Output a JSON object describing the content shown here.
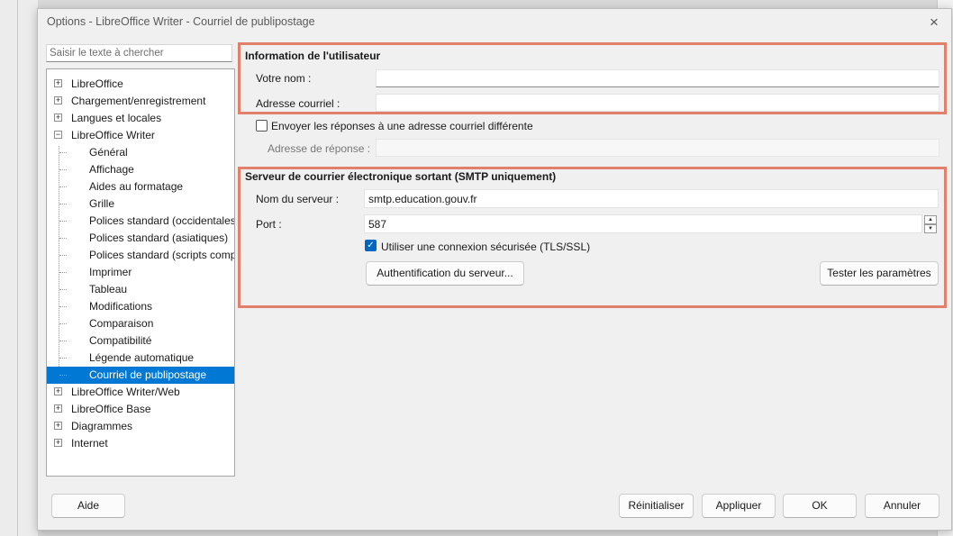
{
  "window": {
    "title": "Options - LibreOffice Writer - Courriel de publipostage",
    "close_icon": "×"
  },
  "search": {
    "placeholder": "Saisir le texte à chercher"
  },
  "tree": {
    "items": [
      {
        "label": "LibreOffice",
        "level": 0,
        "expander": "+"
      },
      {
        "label": "Chargement/enregistrement",
        "level": 0,
        "expander": "+"
      },
      {
        "label": "Langues et locales",
        "level": 0,
        "expander": "+"
      },
      {
        "label": "LibreOffice Writer",
        "level": 0,
        "expander": "−"
      },
      {
        "label": "Général",
        "level": 1
      },
      {
        "label": "Affichage",
        "level": 1
      },
      {
        "label": "Aides au formatage",
        "level": 1
      },
      {
        "label": "Grille",
        "level": 1
      },
      {
        "label": "Polices standard (occidentales)",
        "level": 1
      },
      {
        "label": "Polices standard (asiatiques)",
        "level": 1
      },
      {
        "label": "Polices standard (scripts compl",
        "level": 1
      },
      {
        "label": "Imprimer",
        "level": 1
      },
      {
        "label": "Tableau",
        "level": 1
      },
      {
        "label": "Modifications",
        "level": 1
      },
      {
        "label": "Comparaison",
        "level": 1
      },
      {
        "label": "Compatibilité",
        "level": 1
      },
      {
        "label": "Légende automatique",
        "level": 1
      },
      {
        "label": "Courriel de publipostage",
        "level": 1,
        "selected": true
      },
      {
        "label": "LibreOffice Writer/Web",
        "level": 0,
        "expander": "+"
      },
      {
        "label": "LibreOffice Base",
        "level": 0,
        "expander": "+"
      },
      {
        "label": "Diagrammes",
        "level": 0,
        "expander": "+"
      },
      {
        "label": "Internet",
        "level": 0,
        "expander": "+"
      }
    ]
  },
  "user_info": {
    "title": "Information de l'utilisateur",
    "name_label": "Votre nom :",
    "name_value": "",
    "email_label": "Adresse courriel :",
    "email_value": ""
  },
  "reply": {
    "checkbox_label": "Envoyer les réponses à une adresse courriel différente",
    "checked": false,
    "address_label": "Adresse de réponse :",
    "address_value": ""
  },
  "smtp": {
    "title": "Serveur de courrier électronique sortant (SMTP uniquement)",
    "server_label": "Nom du serveur :",
    "server_value": "smtp.education.gouv.fr",
    "port_label": "Port :",
    "port_value": "587",
    "secure_label": "Utiliser une connexion sécurisée (TLS/SSL)",
    "secure_checked": true,
    "auth_button": "Authentification du serveur...",
    "test_button": "Tester les paramètres"
  },
  "footer": {
    "help": "Aide",
    "reset": "Réinitialiser",
    "apply": "Appliquer",
    "ok": "OK",
    "cancel": "Annuler"
  },
  "colors": {
    "selection": "#0078d4",
    "highlight": "#e0806a",
    "checkbox": "#0067c0"
  }
}
